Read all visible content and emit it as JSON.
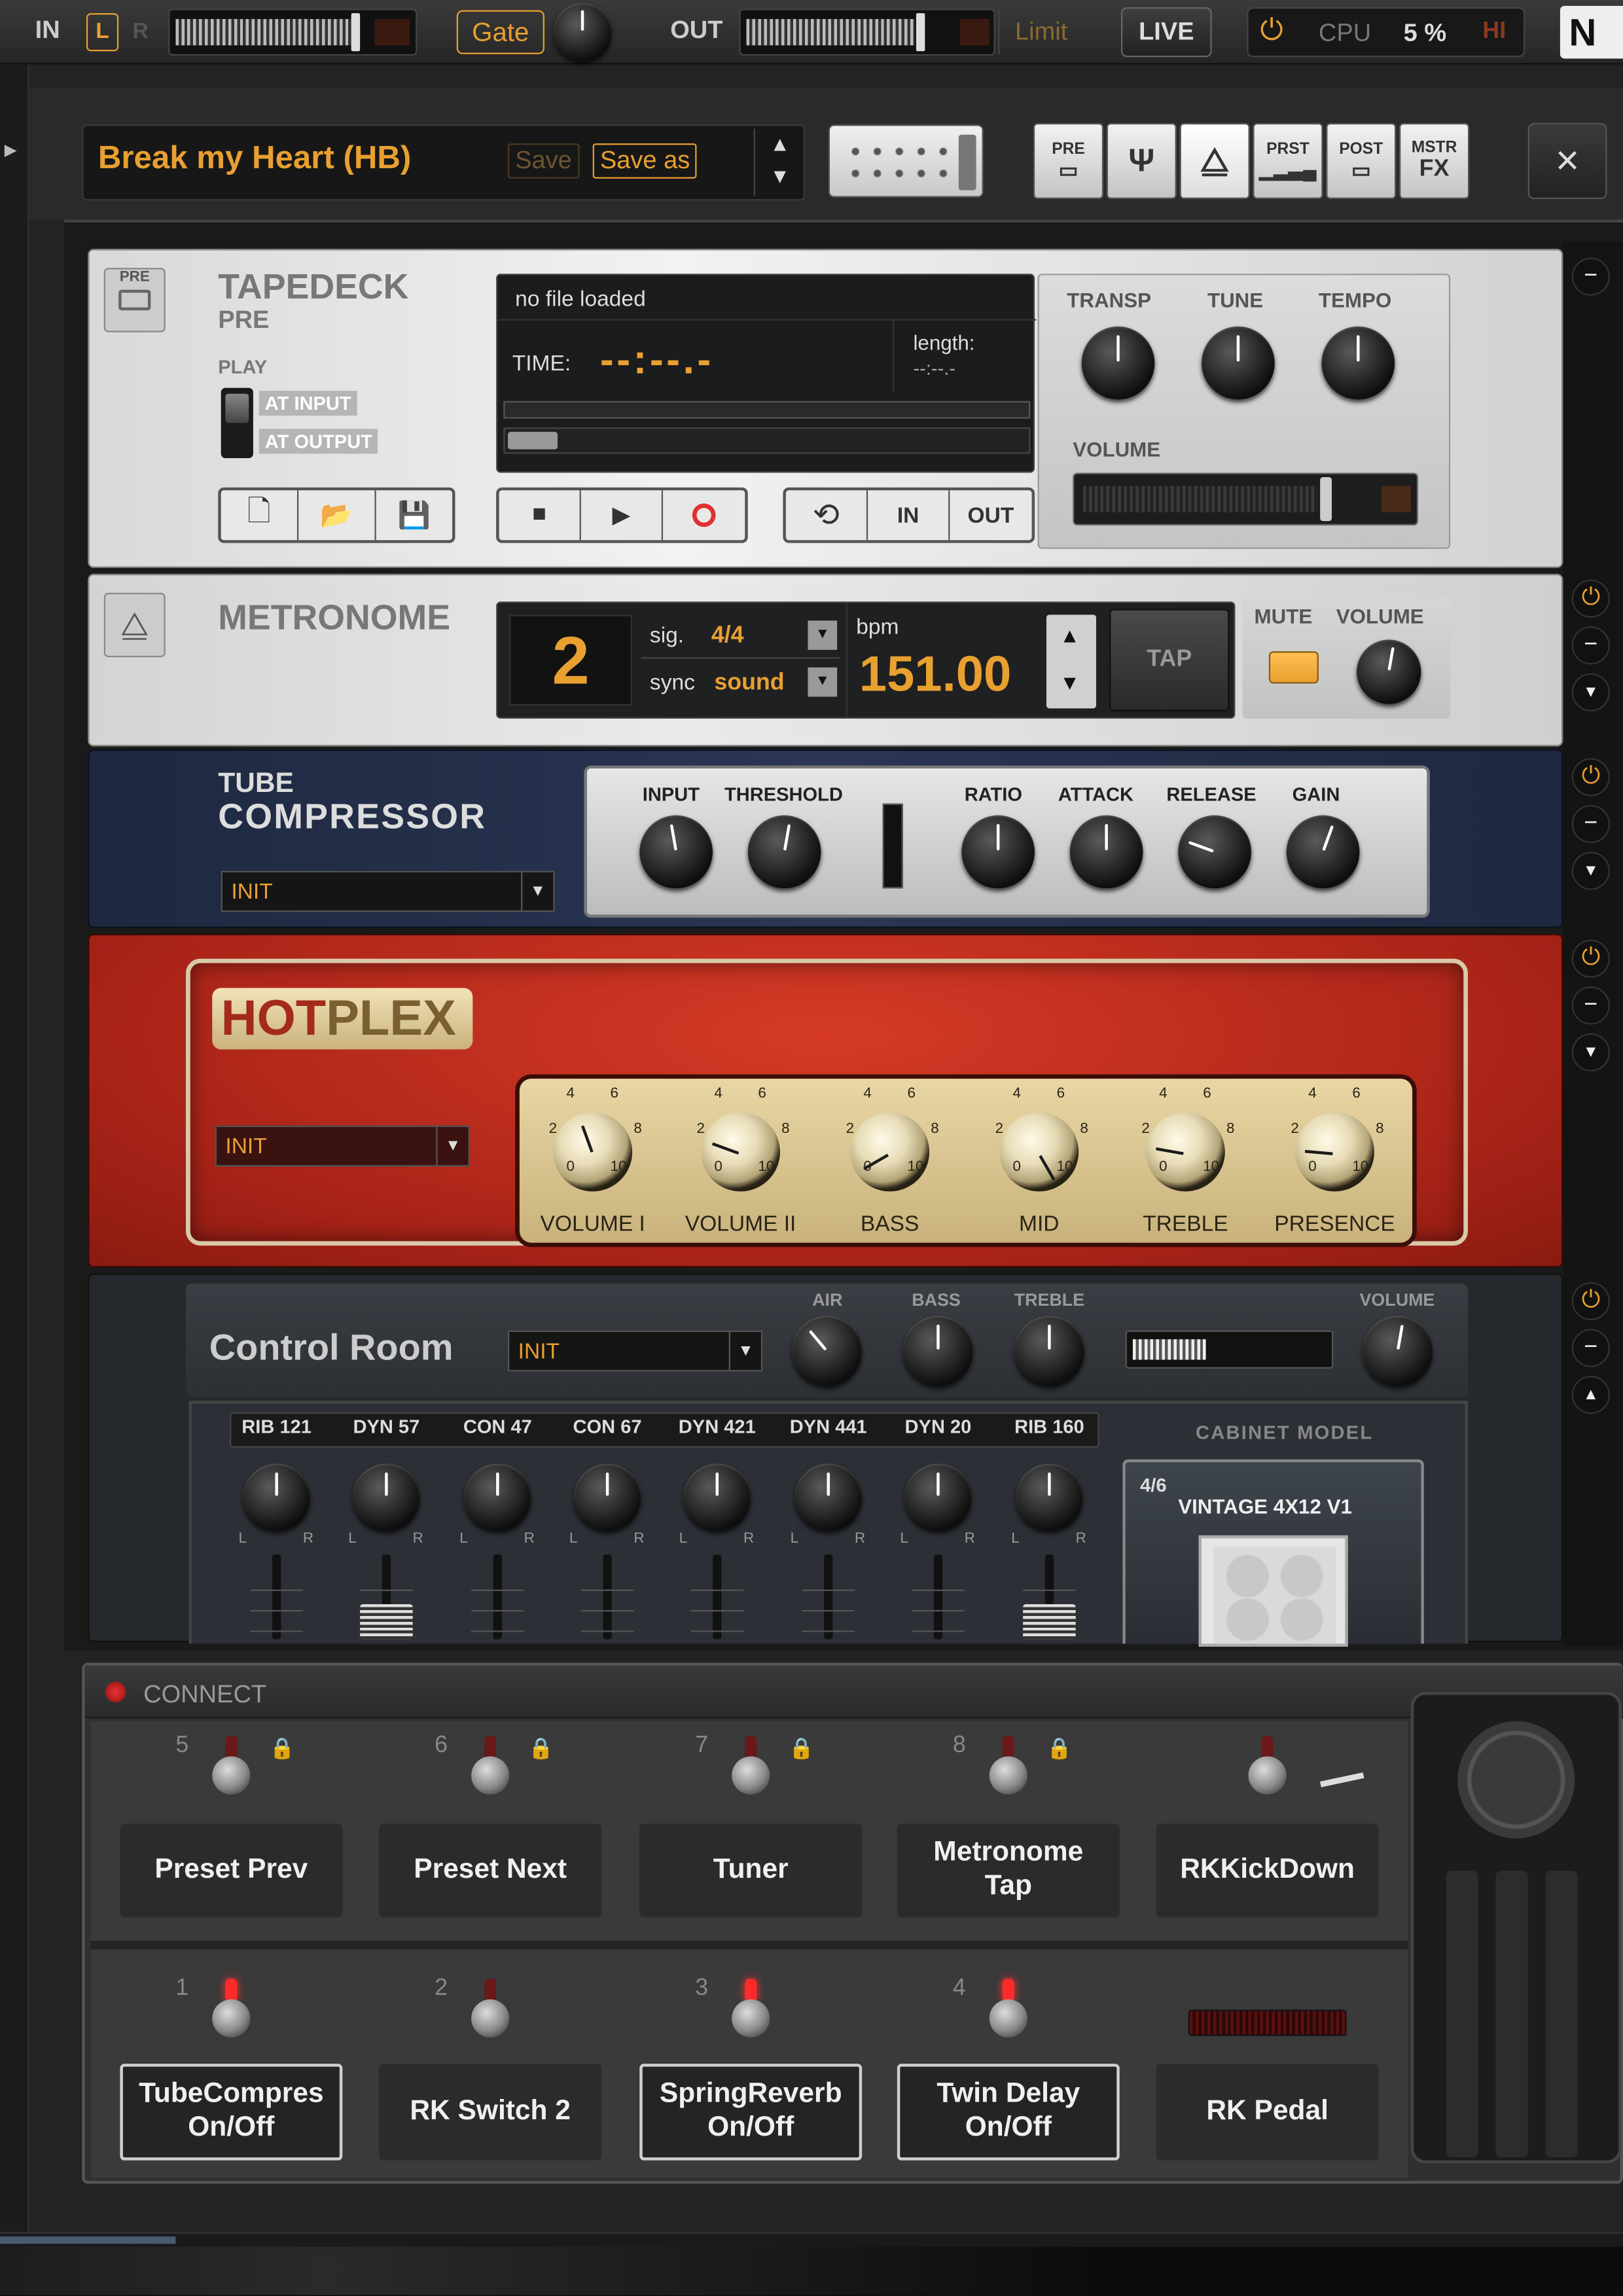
{
  "topbar": {
    "in_label": "IN",
    "l_label": "L",
    "r_label": "R",
    "gate_label": "Gate",
    "out_label": "OUT",
    "limit_label": "Limit",
    "live_label": "LIVE",
    "cpu_label": "CPU",
    "cpu_value": "5 %",
    "hi_label": "HI",
    "logo_label": "N"
  },
  "preset_bar": {
    "preset_name": "Break my Heart (HB)",
    "save_label": "Save",
    "save_as_label": "Save as",
    "tools": [
      {
        "label": "PRE",
        "icon": "tape-icon"
      },
      {
        "label": "",
        "icon": "tuning-fork-icon"
      },
      {
        "label": "",
        "icon": "metronome-icon"
      },
      {
        "label": "PRST",
        "icon": "preset-icon"
      },
      {
        "label": "POST",
        "icon": "tape-icon"
      },
      {
        "label": "MSTR",
        "icon": "fx-icon"
      }
    ],
    "tool_fx_text": "FX",
    "close_glyph": "×"
  },
  "tapedeck": {
    "badge": "PRE",
    "title": "TAPEDECK",
    "subtitle": "PRE",
    "play_label": "PLAY",
    "at_input": "AT INPUT",
    "at_output": "AT OUTPUT",
    "file_status": "no file loaded",
    "time_label": "TIME:",
    "time_value": "--:--.-",
    "length_label": "length:",
    "length_value": "--:--.-",
    "in_label": "IN",
    "out_label": "OUT",
    "knob_labels": [
      "TRANSP",
      "TUNE",
      "TEMPO"
    ],
    "volume_label": "VOLUME"
  },
  "metronome": {
    "title": "METRONOME",
    "beat": "2",
    "sig_label": "sig.",
    "sig_value": "4/4",
    "sync_label": "sync",
    "sync_value": "sound",
    "bpm_label": "bpm",
    "bpm_value": "151.00",
    "tap_label": "TAP",
    "mute_label": "MUTE",
    "volume_label": "VOLUME"
  },
  "compressor": {
    "title_top": "TUBE",
    "title_bottom": "COMPRESSOR",
    "preset": "INIT",
    "knob_labels": [
      "INPUT",
      "THRESHOLD",
      "RATIO",
      "ATTACK",
      "RELEASE",
      "GAIN"
    ]
  },
  "hotplex": {
    "title_hot": "HOT",
    "title_plex": "PLEX",
    "preset": "INIT",
    "knob_labels": [
      "VOLUME I",
      "VOLUME II",
      "BASS",
      "MID",
      "TREBLE",
      "PRESENCE"
    ],
    "scale": {
      "two": "2",
      "four": "4",
      "six": "6",
      "eight": "8",
      "zero": "0",
      "ten": "10"
    }
  },
  "control_room": {
    "title": "Control Room",
    "preset": "INIT",
    "knob_labels": [
      "AIR",
      "BASS",
      "TREBLE"
    ],
    "volume_label": "VOLUME",
    "mics": [
      "RIB 121",
      "DYN 57",
      "CON 47",
      "CON 67",
      "DYN 421",
      "DYN 441",
      "DYN 20",
      "RIB 160"
    ],
    "pan_l": "L",
    "pan_r": "R",
    "cabinet_header": "CABINET MODEL",
    "cabinet_index": "4/6",
    "cabinet_name": "VINTAGE 4X12 V1"
  },
  "connect": {
    "title": "CONNECT",
    "top_row": [
      {
        "num": "5",
        "label": "Preset Prev"
      },
      {
        "num": "6",
        "label": "Preset Next"
      },
      {
        "num": "7",
        "label": "Tuner"
      },
      {
        "num": "8",
        "label": "Metronome Tap"
      },
      {
        "num": "",
        "label": "RKKickDown"
      }
    ],
    "bottom_row": [
      {
        "num": "1",
        "label": "TubeCompres On/Off"
      },
      {
        "num": "2",
        "label": "RK Switch 2"
      },
      {
        "num": "3",
        "label": "SpringReverb On/Off"
      },
      {
        "num": "4",
        "label": "Twin Delay On/Off"
      },
      {
        "num": "",
        "label": "RK Pedal"
      }
    ]
  },
  "colors": {
    "accent": "#e8a030",
    "amp_red": "#b8281c",
    "compressor_blue": "#23304a"
  }
}
